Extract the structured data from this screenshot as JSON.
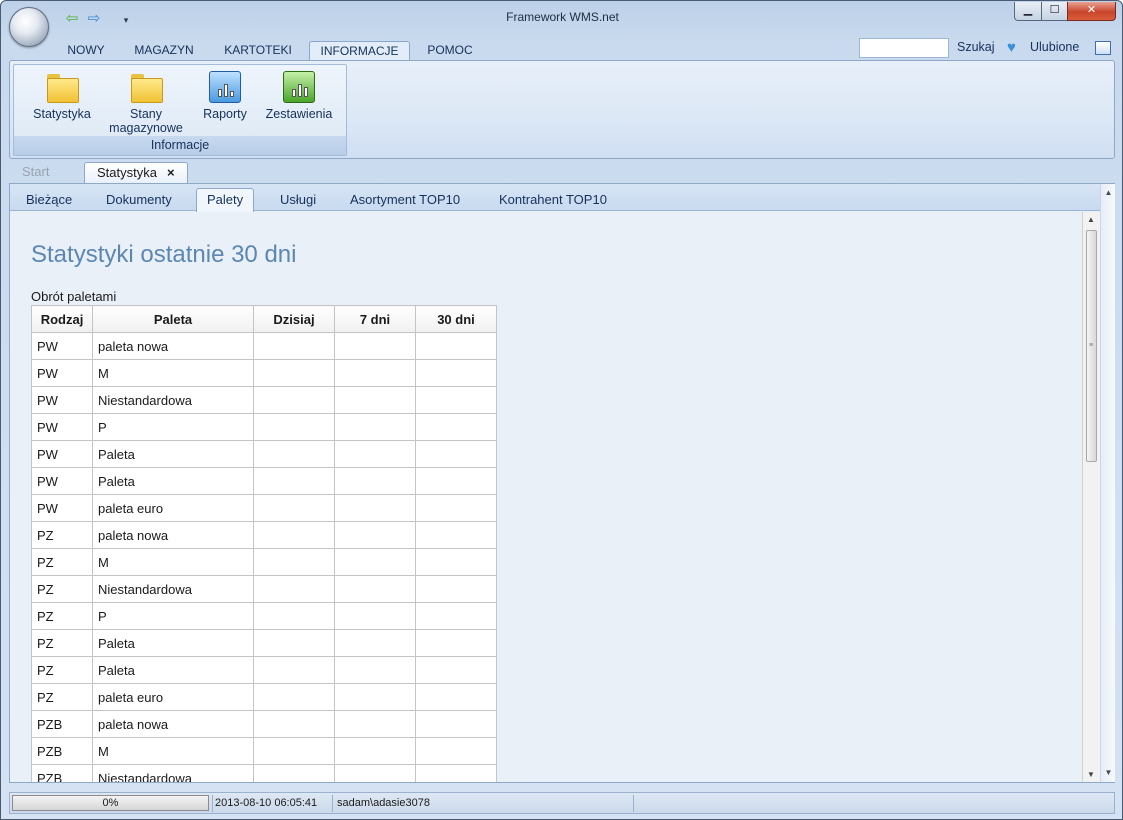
{
  "window": {
    "title": "Framework WMS.net"
  },
  "quick_access": {
    "back_icon": "arrow-left-icon",
    "forward_icon": "arrow-right-icon",
    "dropdown_icon": "chevron-down-icon"
  },
  "ribbon": {
    "tabs": [
      {
        "label": "NOWY"
      },
      {
        "label": "MAGAZYN"
      },
      {
        "label": "KARTOTEKI"
      },
      {
        "label": "INFORMACJE",
        "active": true
      },
      {
        "label": "POMOC"
      }
    ],
    "search": {
      "label": "Szukaj",
      "value": ""
    },
    "favorites": {
      "label": "Ulubione"
    },
    "group": {
      "label": "Informacje",
      "buttons": [
        {
          "label": "Statystyka",
          "icon": "folder-icon"
        },
        {
          "label1": "Stany",
          "label2": "magazynowe",
          "icon": "folder-icon"
        },
        {
          "label": "Raporty",
          "icon": "bar-chart-icon"
        },
        {
          "label": "Zestawienia",
          "icon": "bar-chart-icon"
        }
      ]
    }
  },
  "doc_tabs": [
    {
      "label": "Start"
    },
    {
      "label": "Statystyka",
      "active": true,
      "close": "×"
    }
  ],
  "sub_tabs": [
    {
      "label": "Bieżące"
    },
    {
      "label": "Dokumenty"
    },
    {
      "label": "Palety",
      "active": true
    },
    {
      "label": "Usługi"
    },
    {
      "label": "Asortyment TOP10"
    },
    {
      "label": "Kontrahent TOP10"
    }
  ],
  "content": {
    "title": "Statystyki ostatnie 30 dni",
    "section": "Obrót paletami",
    "table": {
      "headers": [
        "Rodzaj",
        "Paleta",
        "Dzisiaj",
        "7 dni",
        "30 dni"
      ],
      "rows": [
        [
          "PW",
          "paleta nowa",
          "",
          "",
          ""
        ],
        [
          "PW",
          "M",
          "",
          "",
          ""
        ],
        [
          "PW",
          "Niestandardowa",
          "",
          "",
          ""
        ],
        [
          "PW",
          "P",
          "",
          "",
          ""
        ],
        [
          "PW",
          "Paleta",
          "",
          "",
          ""
        ],
        [
          "PW",
          "Paleta",
          "",
          "",
          ""
        ],
        [
          "PW",
          "paleta euro",
          "",
          "",
          ""
        ],
        [
          "PZ",
          "paleta nowa",
          "",
          "",
          ""
        ],
        [
          "PZ",
          "M",
          "",
          "",
          ""
        ],
        [
          "PZ",
          "Niestandardowa",
          "",
          "",
          ""
        ],
        [
          "PZ",
          "P",
          "",
          "",
          ""
        ],
        [
          "PZ",
          "Paleta",
          "",
          "",
          ""
        ],
        [
          "PZ",
          "Paleta",
          "",
          "",
          ""
        ],
        [
          "PZ",
          "paleta euro",
          "",
          "",
          ""
        ],
        [
          "PZB",
          "paleta nowa",
          "",
          "",
          ""
        ],
        [
          "PZB",
          "M",
          "",
          "",
          ""
        ],
        [
          "PZB",
          "Niestandardowa",
          "",
          "",
          ""
        ]
      ]
    }
  },
  "status": {
    "progress_text": "0%",
    "progress_value": 0,
    "datetime": "2013-08-10 06:05:41",
    "user": "sadam\\adasie3078"
  }
}
